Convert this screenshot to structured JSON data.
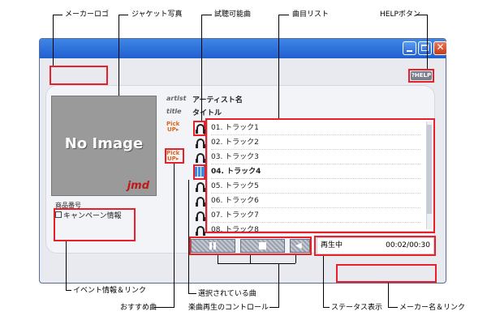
{
  "annotations": {
    "maker_logo": "メーカーロゴ",
    "jacket_photo": "ジャケット写真",
    "preview_track": "試聴可能曲",
    "track_list": "曲目リスト",
    "help_button": "HELPボタン",
    "event_info": "イベント情報＆リンク",
    "recommended_track": "おすすめ曲",
    "selected_track": "選択されている曲",
    "playback_control": "楽曲再生のコントロール",
    "status_display": "ステータス表示",
    "maker_link": "メーカー名＆リンク"
  },
  "player": {
    "help_label": "HELP",
    "artist_label": "artist",
    "title_label": "title",
    "artist_name": "アーティスト名",
    "title_name": "タイトル",
    "no_image": "No Image",
    "jacket_brand": "jmd",
    "product_number_label": "商品番号",
    "campaign_label": "キャンペーン情報",
    "pickup_label_1": "Pick",
    "pickup_label_2": "UP",
    "status_text": "再生中",
    "status_time": "00:02/00:30"
  },
  "tracks": [
    {
      "label": "01. トラック1",
      "icon": "headphones-icon"
    },
    {
      "label": "02. トラック2",
      "icon": "headphones-icon"
    },
    {
      "label": "03. トラック3",
      "icon": "headphones-icon"
    },
    {
      "label": "04. トラック4",
      "icon": "equalizer-icon",
      "selected": true
    },
    {
      "label": "05. トラック5",
      "icon": "headphones-icon"
    },
    {
      "label": "06. トラック6",
      "icon": "headphones-icon"
    },
    {
      "label": "07. トラック7",
      "icon": "headphones-icon"
    },
    {
      "label": "08. トラック8",
      "icon": "headphones-icon"
    }
  ],
  "colors": {
    "annotation_box": "#e8202a",
    "titlebar": "#1f5fd0",
    "pickup": "#e0641a"
  }
}
